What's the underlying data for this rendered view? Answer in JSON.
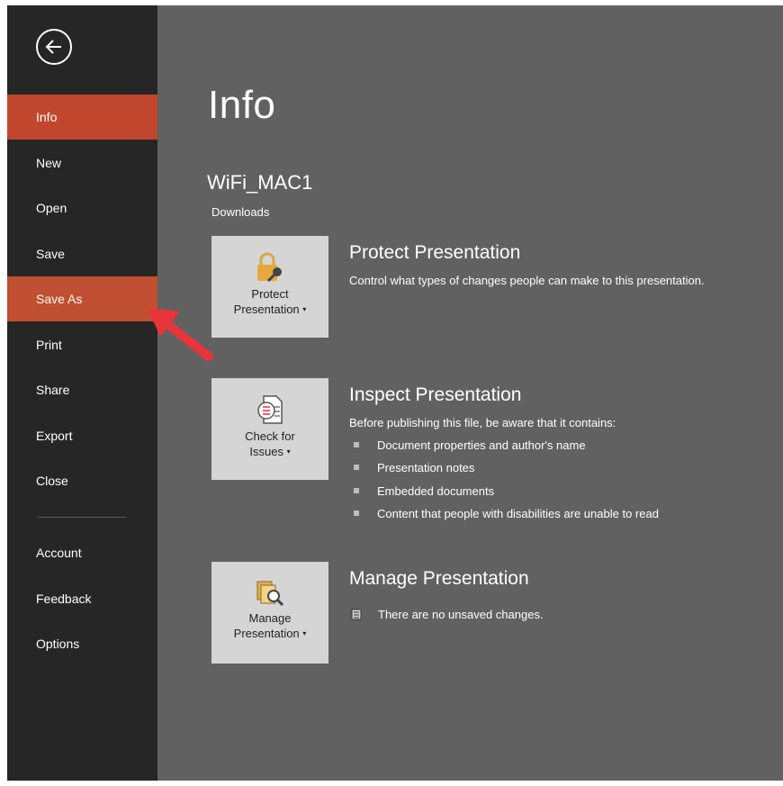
{
  "sidebar": {
    "items": [
      {
        "label": "Info"
      },
      {
        "label": "New"
      },
      {
        "label": "Open"
      },
      {
        "label": "Save"
      },
      {
        "label": "Save As"
      },
      {
        "label": "Print"
      },
      {
        "label": "Share"
      },
      {
        "label": "Export"
      },
      {
        "label": "Close"
      },
      {
        "label": "Account"
      },
      {
        "label": "Feedback"
      },
      {
        "label": "Options"
      }
    ]
  },
  "main": {
    "title": "Info",
    "file_name": "WiFi_MAC1",
    "file_location": "Downloads",
    "protect": {
      "tile_line1": "Protect",
      "tile_line2": "Presentation",
      "heading": "Protect Presentation",
      "description": "Control what types of changes people can make to this presentation."
    },
    "inspect": {
      "tile_line1": "Check for",
      "tile_line2": "Issues",
      "heading": "Inspect Presentation",
      "description": "Before publishing this file, be aware that it contains:",
      "items": [
        "Document properties and author's name",
        "Presentation notes",
        "Embedded documents",
        "Content that people with disabilities are unable to read"
      ]
    },
    "manage": {
      "tile_line1": "Manage",
      "tile_line2": "Presentation",
      "heading": "Manage Presentation",
      "status": "There are no unsaved changes."
    }
  },
  "colors": {
    "sidebar_bg": "#262626",
    "main_bg": "#616161",
    "accent": "#c0472e",
    "tile_bg": "#d5d5d5",
    "annotation_arrow": "#e8353a"
  },
  "icons": [
    "back-arrow-icon",
    "lock-key-icon",
    "checklist-icon",
    "manage-docs-icon",
    "document-status-icon",
    "red-pointer-arrow"
  ]
}
